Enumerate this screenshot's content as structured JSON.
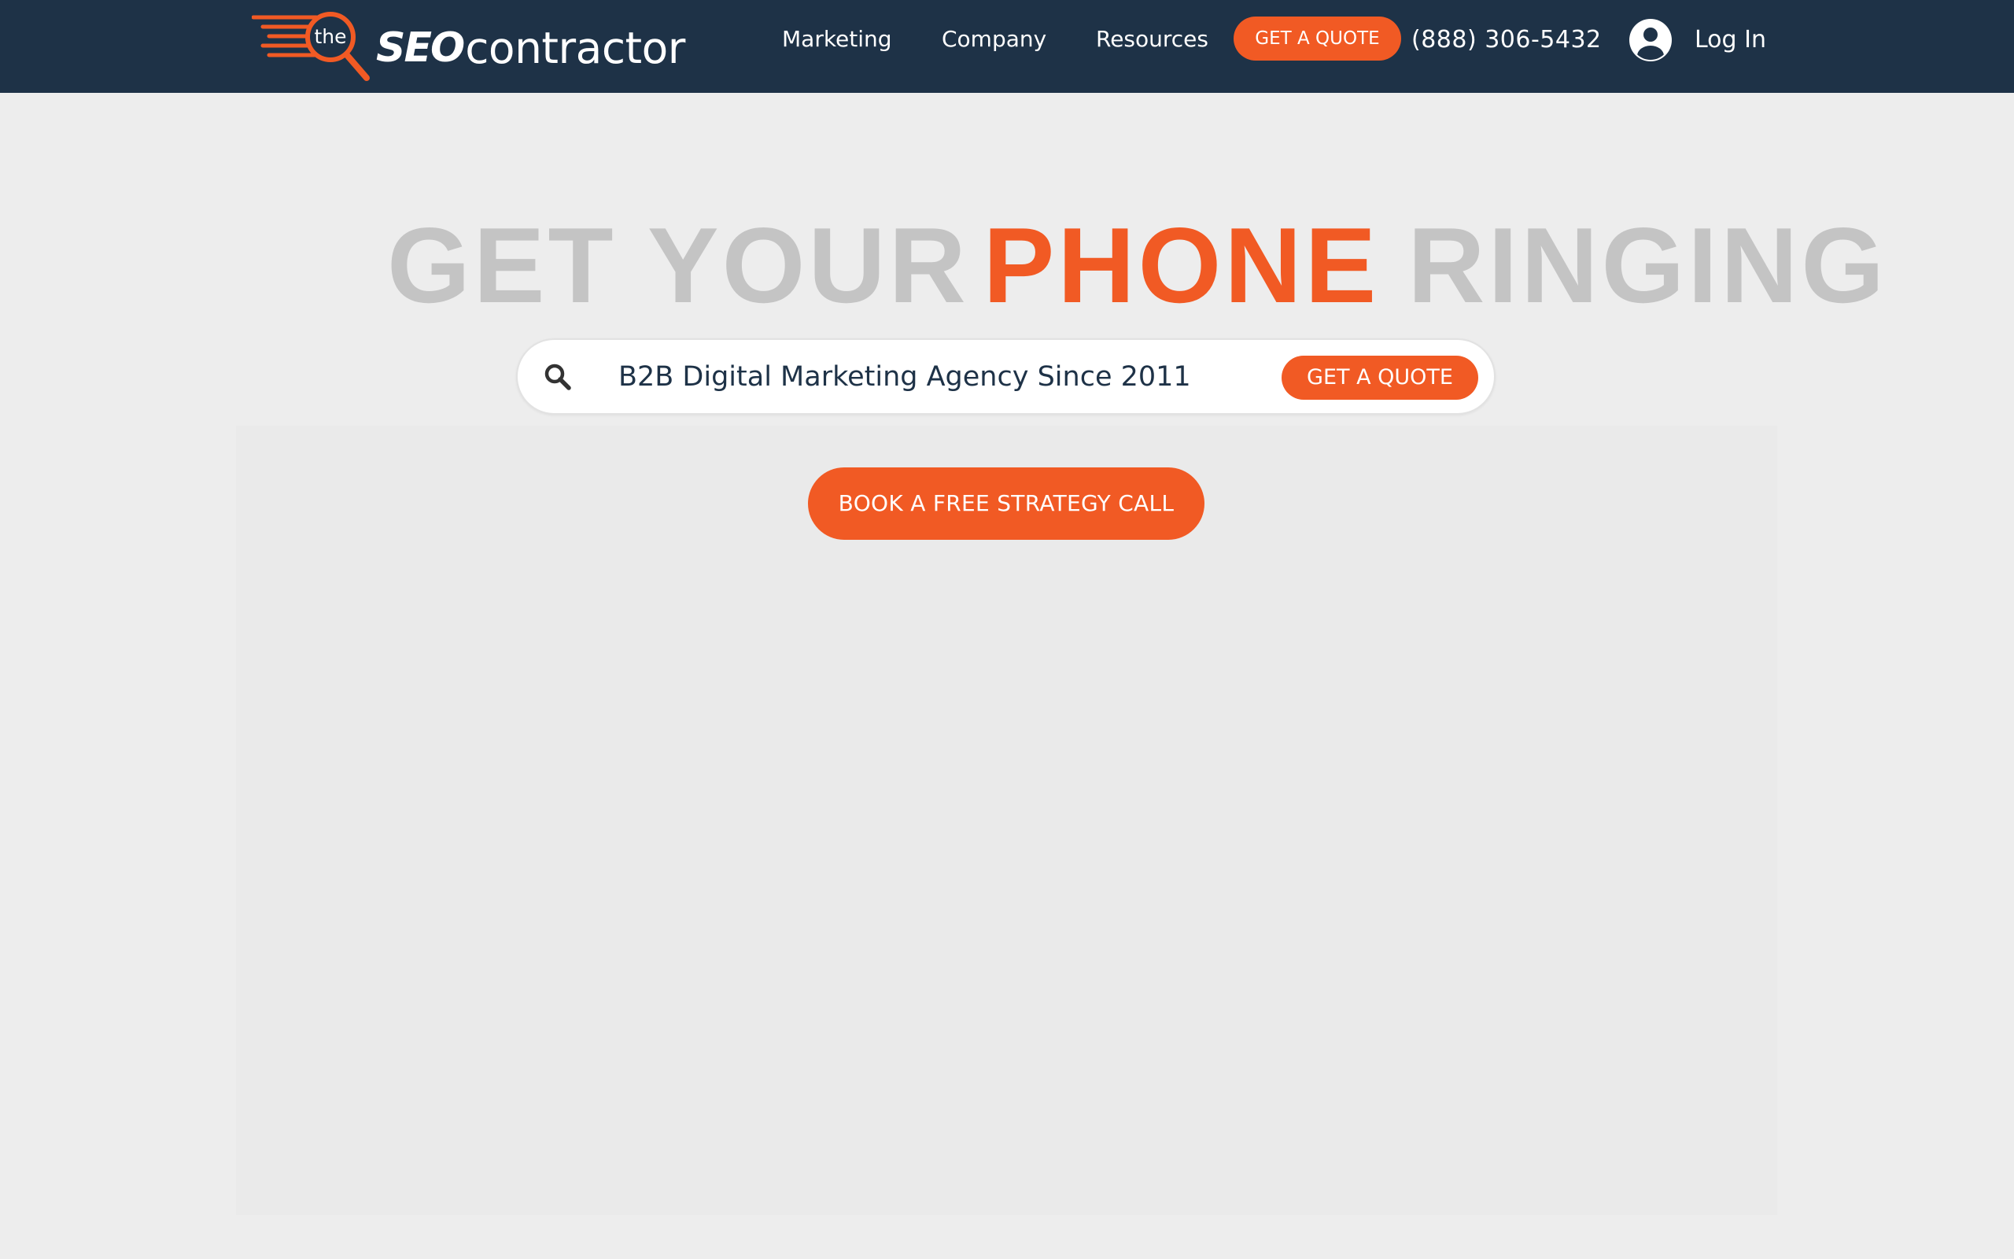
{
  "header": {
    "logo": {
      "the": "the",
      "seo": "SEO",
      "contractor": "contractor"
    },
    "nav": {
      "marketing": "Marketing",
      "company": "Company",
      "resources": "Resources"
    },
    "quote_label": "GET A QUOTE",
    "phone": "(888) 306-5432",
    "login_label": "Log In"
  },
  "hero": {
    "headline_part1": "GET YOUR",
    "headline_highlight": "PHONE",
    "headline_part2": "RINGING",
    "search": {
      "value": "B2B Digital Marketing Agency Since 2011",
      "button_label": "GET A QUOTE"
    },
    "cta_label": "BOOK A FREE STRATEGY CALL"
  },
  "colors": {
    "navy": "#1e3247",
    "accent_orange": "#f15a24",
    "headline_gray": "#c4c4c4",
    "page_background": "#ededed"
  },
  "icons": {
    "logo": "magnifier-with-speed-lines-icon",
    "login": "user-circle-icon",
    "search": "search-icon"
  }
}
